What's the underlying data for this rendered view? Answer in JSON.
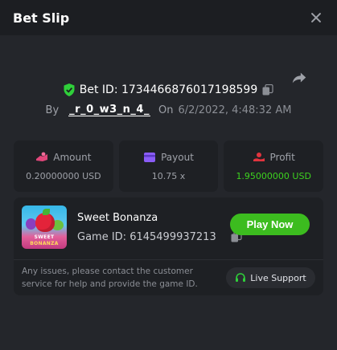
{
  "header": {
    "title": "Bet Slip"
  },
  "bet": {
    "id_text": "Bet ID: 1734466876017198599",
    "by_label": "By",
    "username": "_r_0_w3_n_4_",
    "on_label": "On",
    "date": "6/2/2022, 4:48:32 AM"
  },
  "stats": [
    {
      "label": "Amount",
      "value": "0.20000000 USD",
      "icon": "amount-icon",
      "color": "#e0467a"
    },
    {
      "label": "Payout",
      "value": "10.75 x",
      "icon": "payout-icon",
      "color": "#8a5cf6"
    },
    {
      "label": "Profit",
      "value": "1.95000000 USD",
      "icon": "profit-icon",
      "color": "#e0343e"
    }
  ],
  "game": {
    "name": "Sweet Bonanza",
    "id_text": "Game ID: 6145499937213",
    "play_label": "Play Now",
    "thumb_line1": "SWEET",
    "thumb_line2": "BONANZA"
  },
  "support": {
    "note": "Any issues, please contact the customer service for help and provide the game ID.",
    "live_label": "Live Support"
  },
  "colors": {
    "accent_green": "#3cbc1f",
    "profit_green": "#3dd11f"
  }
}
